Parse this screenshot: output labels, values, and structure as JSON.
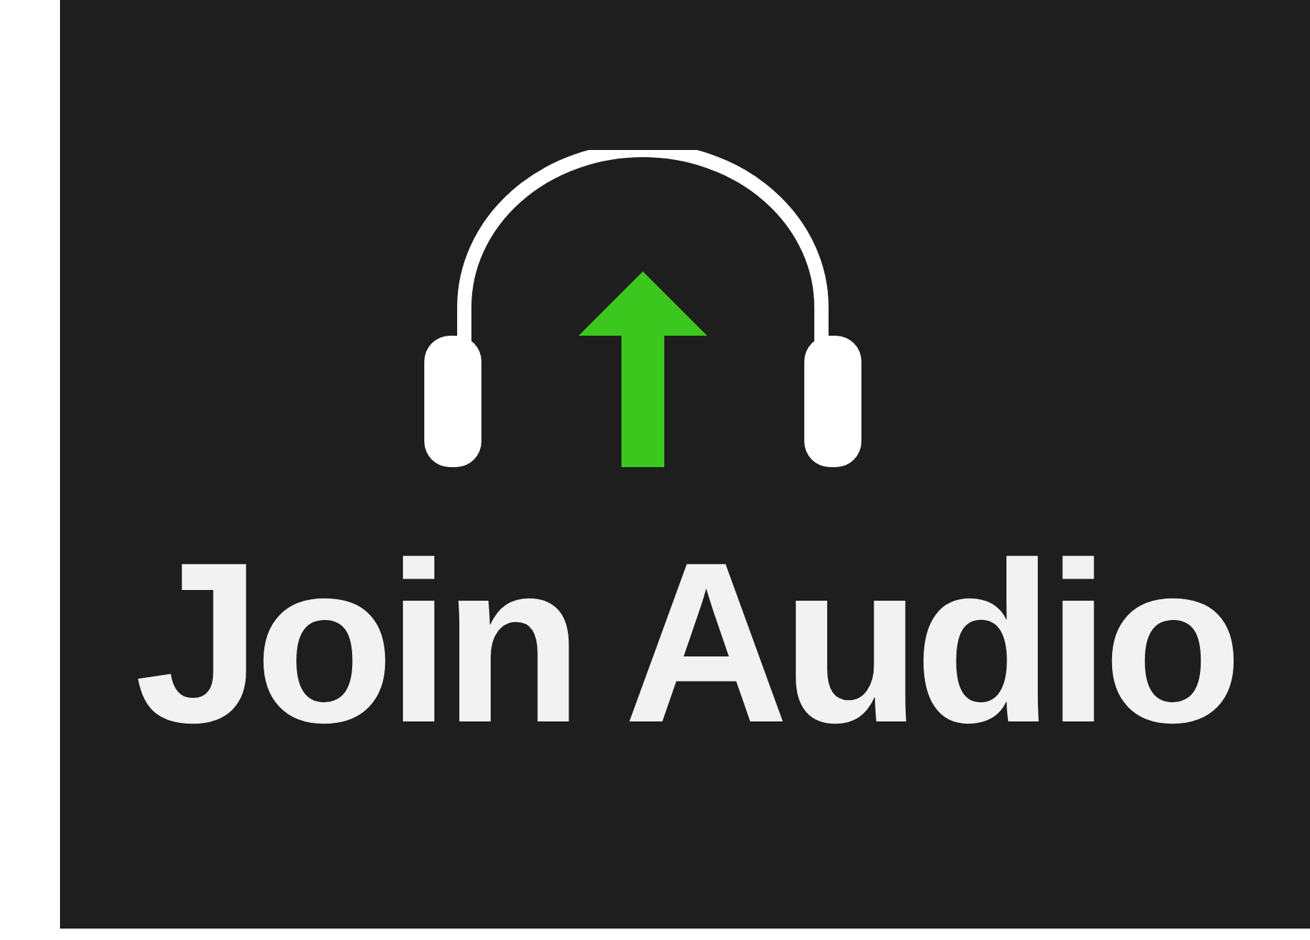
{
  "button": {
    "label": "Join Audio"
  }
}
